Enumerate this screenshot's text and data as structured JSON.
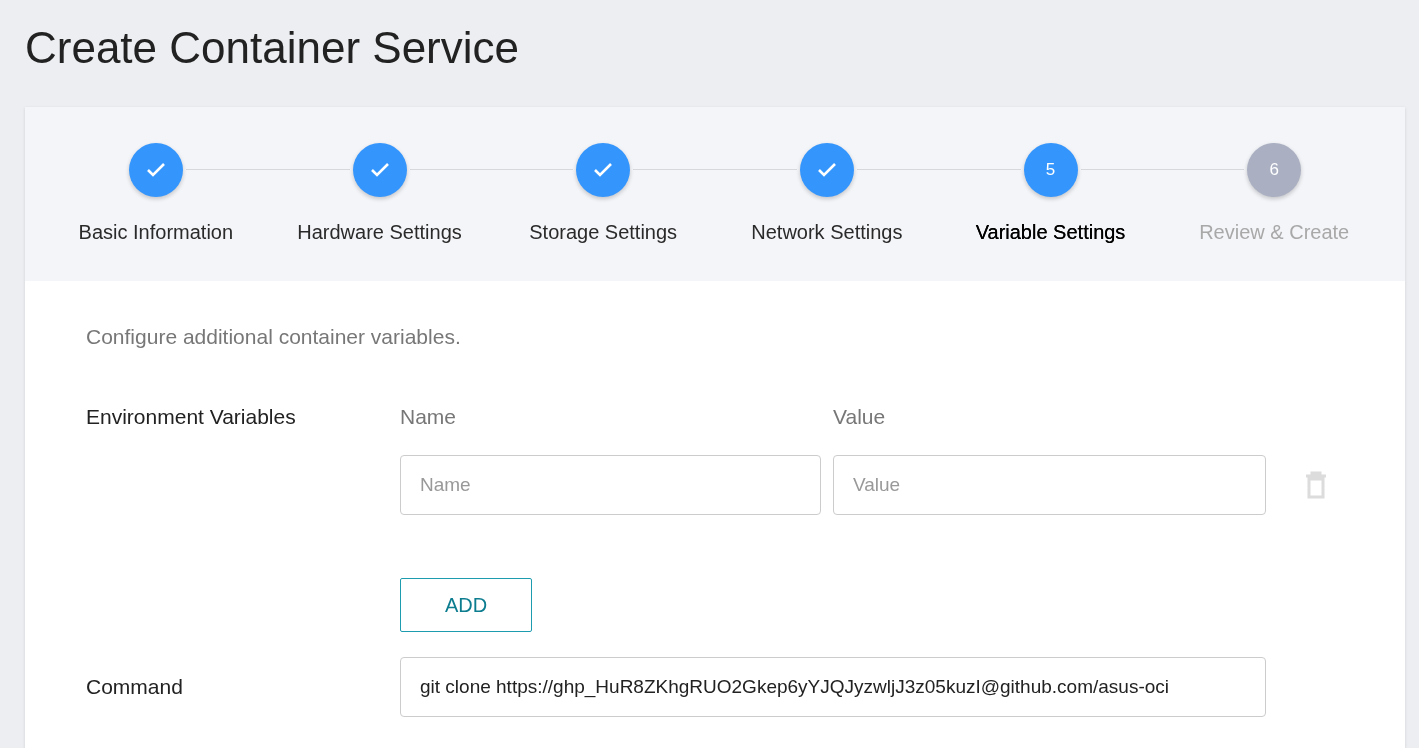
{
  "page_title": "Create Container Service",
  "steps": [
    {
      "label": "Basic Information",
      "completed": true,
      "selected": false
    },
    {
      "label": "Hardware Settings",
      "completed": true,
      "selected": false
    },
    {
      "label": "Storage Settings",
      "completed": true,
      "selected": false
    },
    {
      "label": "Network Settings",
      "completed": true,
      "selected": false
    },
    {
      "number": "5",
      "label": "Variable Settings",
      "completed": false,
      "selected": true
    },
    {
      "number": "6",
      "label": "Review & Create",
      "completed": false,
      "selected": false
    }
  ],
  "description": "Configure additional container variables.",
  "env_vars": {
    "label": "Environment Variables",
    "name_header": "Name",
    "value_header": "Value",
    "rows": [
      {
        "name_placeholder": "Name",
        "value_placeholder": "Value"
      }
    ],
    "add_button": "ADD"
  },
  "command": {
    "label": "Command",
    "value": "git clone https://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@github.com/asus-oci"
  }
}
